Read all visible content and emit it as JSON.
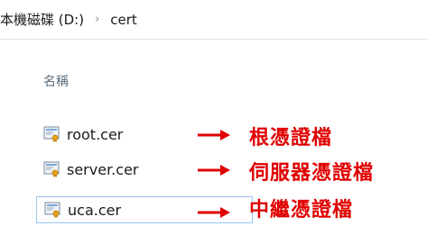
{
  "breadcrumb": {
    "drive": "本機磁碟 (D:)",
    "separator": "›",
    "folder": "cert"
  },
  "file_list": {
    "column_header": "名稱",
    "items": [
      {
        "name": "root.cer",
        "annotation": "根憑證檔",
        "selected": false
      },
      {
        "name": "server.cer",
        "annotation": "伺服器憑證檔",
        "selected": false
      },
      {
        "name": "uca.cer",
        "annotation": "中繼憑證檔",
        "selected": true
      }
    ]
  },
  "colors": {
    "annotation": "#e00000",
    "selection_border": "#99c6f5",
    "header_text": "#5a6b7b"
  },
  "icons": {
    "file": "certificate-file-icon",
    "arrow": "right-arrow-icon",
    "separator": "chevron-right-icon"
  }
}
